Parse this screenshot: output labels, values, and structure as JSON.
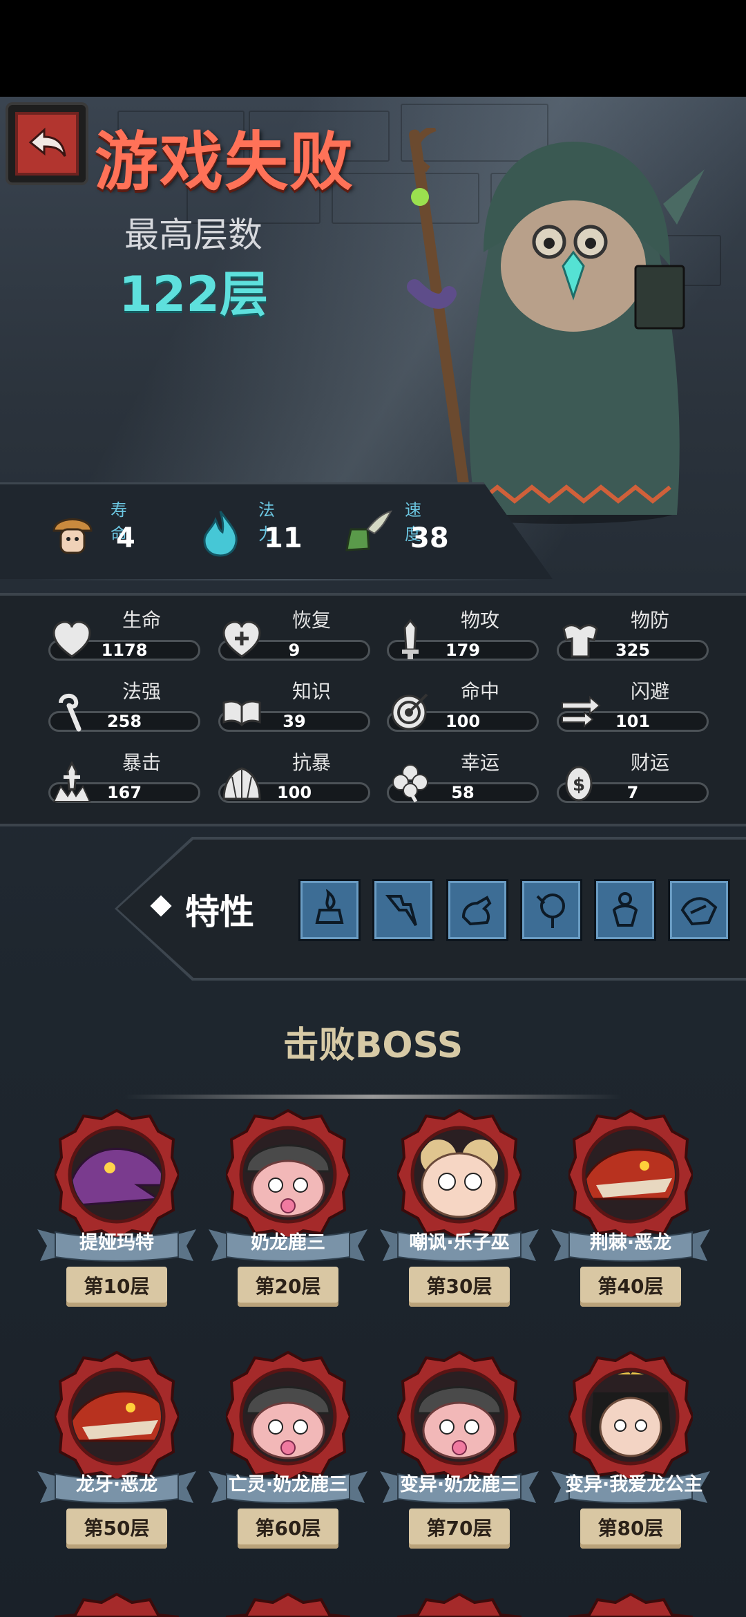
{
  "header": {
    "title": "游戏失败",
    "highest_floor_label": "最高层数",
    "highest_floor_value": "122层"
  },
  "resources": [
    {
      "label": "寿命",
      "value": "4",
      "icon": "mushroom-character-icon"
    },
    {
      "label": "法力",
      "value": "11",
      "icon": "blue-flame-icon"
    },
    {
      "label": "速度",
      "value": "38",
      "icon": "winged-boot-icon"
    }
  ],
  "stats": [
    {
      "name": "生命",
      "value": "1178",
      "icon": "heart-icon"
    },
    {
      "name": "恢复",
      "value": "9",
      "icon": "heart-plus-icon"
    },
    {
      "name": "物攻",
      "value": "179",
      "icon": "sword-icon"
    },
    {
      "name": "物防",
      "value": "325",
      "icon": "armor-icon"
    },
    {
      "name": "法强",
      "value": "258",
      "icon": "staff-icon"
    },
    {
      "name": "知识",
      "value": "39",
      "icon": "book-icon"
    },
    {
      "name": "命中",
      "value": "100",
      "icon": "target-icon"
    },
    {
      "name": "闪避",
      "value": "101",
      "icon": "dodge-arrows-icon"
    },
    {
      "name": "暴击",
      "value": "167",
      "icon": "crit-dagger-icon"
    },
    {
      "name": "抗暴",
      "value": "100",
      "icon": "shell-shield-icon"
    },
    {
      "name": "幸运",
      "value": "58",
      "icon": "clover-icon"
    },
    {
      "name": "财运",
      "value": "7",
      "icon": "coin-icon"
    }
  ],
  "traits": {
    "label": "特性",
    "icons": [
      "trait-fire-icon",
      "trait-lightning-icon",
      "trait-hand-icon",
      "trait-tree-icon",
      "trait-figure-icon",
      "trait-wave-icon"
    ]
  },
  "boss_section": {
    "title": "击败BOSS"
  },
  "bosses": [
    {
      "name": "提娅玛特",
      "floor": "第10层",
      "portrait": "purple-dragon"
    },
    {
      "name": "奶龙鹿三",
      "floor": "第20层",
      "portrait": "helmet-baby"
    },
    {
      "name": "嘲讽·乐子巫",
      "floor": "第30层",
      "portrait": "curly-witch"
    },
    {
      "name": "荆棘·恶龙",
      "floor": "第40层",
      "portrait": "red-dragon"
    },
    {
      "name": "龙牙·恶龙",
      "floor": "第50层",
      "portrait": "red-dragon"
    },
    {
      "name": "亡灵·奶龙鹿三",
      "floor": "第60层",
      "portrait": "helmet-baby"
    },
    {
      "name": "变异·奶龙鹿三",
      "floor": "第70层",
      "portrait": "helmet-baby"
    },
    {
      "name": "变异·我爱龙公主",
      "floor": "第80层",
      "portrait": "princess"
    }
  ],
  "colors": {
    "title": "#ff7258",
    "floor_value": "#5ee0dd",
    "resource_label": "#6cc7e2",
    "trait_tile": "#3d6d95",
    "boss_frame": "#a52a2a"
  }
}
